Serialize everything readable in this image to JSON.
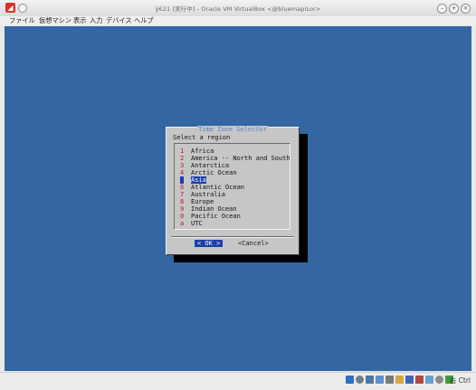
{
  "window": {
    "title": "ÿ€21 [実行中] - Oracle VM VirtualBox <@bluemapiLor>"
  },
  "menubar": {
    "items": [
      "ファイル",
      "仮想マシン",
      "表示",
      "入力",
      "デバイス",
      "ヘルプ"
    ]
  },
  "dialog": {
    "title": "Time Zone Selector",
    "prompt": "Select a region",
    "items": [
      {
        "tag": "1",
        "name": "Africa"
      },
      {
        "tag": "2",
        "name": "America -- North and South"
      },
      {
        "tag": "3",
        "name": "Antarctica"
      },
      {
        "tag": "4",
        "name": "Arctic Ocean"
      },
      {
        "tag": "5",
        "name": "Asia",
        "selected": true
      },
      {
        "tag": "6",
        "name": "Atlantic Ocean"
      },
      {
        "tag": "7",
        "name": "Australia"
      },
      {
        "tag": "8",
        "name": "Europe"
      },
      {
        "tag": "9",
        "name": "Indian Ocean"
      },
      {
        "tag": "0",
        "name": "Pacific Ocean"
      },
      {
        "tag": "a",
        "name": "UTC"
      }
    ],
    "ok_label": "< OK >",
    "cancel_label": "<Cancel>"
  },
  "statusbar": {
    "host_key": "右 Ctrl",
    "icons": [
      "hard-disk-icon",
      "optical-drive-icon",
      "audio-icon",
      "network-icon",
      "usb-icon",
      "shared-folders-icon",
      "display-icon",
      "video-capture-icon",
      "cpu-icon",
      "mouse-integration-icon",
      "keyboard-icon"
    ],
    "icon_colors": [
      "#2f6fbf",
      "#6d7f8f",
      "#4a78a8",
      "#5b8fd0",
      "#7a7a7a",
      "#d6a640",
      "#3f65b5",
      "#b04848",
      "#6aa0d0",
      "#8a8a8a",
      "#3c9a3c"
    ]
  }
}
